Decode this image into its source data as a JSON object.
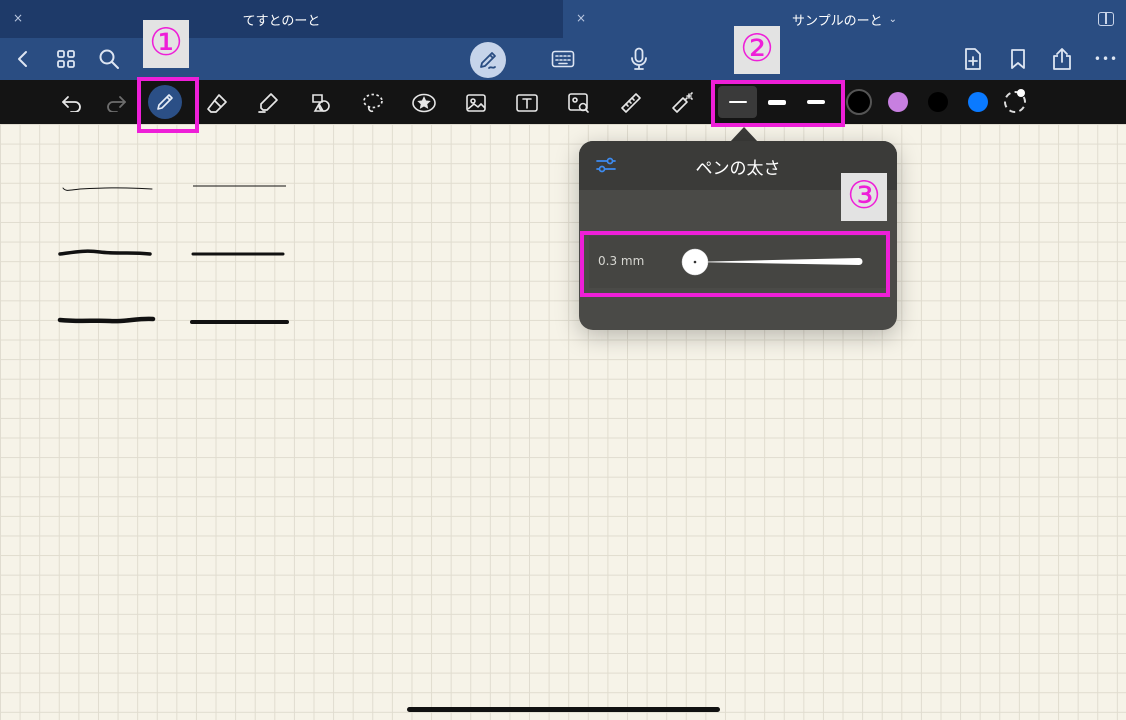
{
  "tabs": [
    {
      "title": "てすとのーと",
      "close": "×"
    },
    {
      "title": "サンプルのーと",
      "close": "×",
      "chevron": "⌄"
    }
  ],
  "navbar": {
    "icons": [
      "back-icon",
      "grid-icon",
      "search-icon",
      "pen-mode-icon",
      "keyboard-icon",
      "microphone-icon",
      "add-page-icon",
      "bookmark-icon",
      "share-icon",
      "more-icon"
    ],
    "more_label": "•••"
  },
  "toolbar": {
    "tools": [
      "undo-icon",
      "redo-icon",
      "pen-icon",
      "eraser-icon",
      "highlighter-icon",
      "shapes-icon",
      "lasso-icon",
      "sticker-icon",
      "image-icon",
      "text-icon",
      "camera-scan-icon",
      "ruler-icon",
      "laser-pointer-icon"
    ],
    "widths": [
      "thin",
      "medium",
      "thick"
    ],
    "selected_width": "thin",
    "colors": [
      "#000000",
      "#c77fe0",
      "#000000",
      "#0a7aff"
    ],
    "selected_color": "#000000"
  },
  "annotations": {
    "one": "①",
    "two": "②",
    "three": "③"
  },
  "popover": {
    "title": "ペンの太さ",
    "value": "0.3 mm",
    "slider_fraction": 0.0
  },
  "accent": "#ee1fd8"
}
